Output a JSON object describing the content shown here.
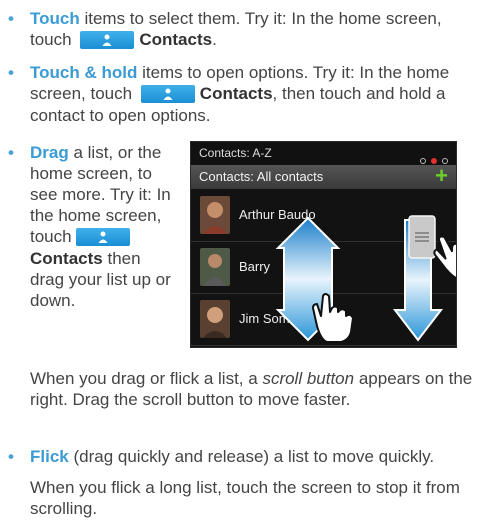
{
  "items": [
    {
      "keyword": "Touch",
      "text1": " items to select them. Try it: In the home screen, touch",
      "contacts": "Contacts",
      "text2": "."
    },
    {
      "keyword": "Touch & hold",
      "text1": " items to open options. Try it: In the home screen, touch",
      "contacts": "Contacts",
      "text2": ", then touch and hold a contact to open options."
    },
    {
      "keyword": "Drag",
      "text1": " a list, or the home screen, to see more. Try it: In the home screen, touch",
      "contacts": "Contacts",
      "text2": "then drag your list up or down."
    },
    {
      "keyword": "Flick",
      "text1": " (drag quickly and release) a list to move quickly."
    }
  ],
  "drag_note": {
    "text1": "When you drag or flick a list, a ",
    "emphasis": "scroll button",
    "text2": " appears on the right. Drag the scroll button to move faster."
  },
  "flick_note": "When you flick a long list, touch the screen to stop it from scrolling.",
  "phone": {
    "status_title": "Contacts: A-Z",
    "header_title": "Contacts: All contacts",
    "add_symbol": "+",
    "contacts": [
      "Arthur Baudo",
      "Barry",
      "Jim Somers"
    ]
  },
  "colors": {
    "keyword": "#3a9bd5",
    "button": "#1b8ed4",
    "add": "#6bd12a",
    "arrow": "#2d8fd0"
  },
  "icons": {
    "contacts_button": "person-icon",
    "gesture": "hand-icon",
    "scroll_button": "scroll-handle-icon"
  }
}
